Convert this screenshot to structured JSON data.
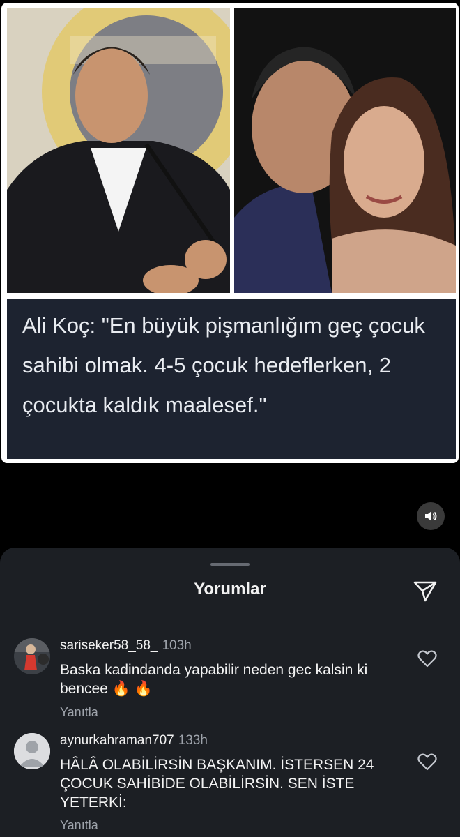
{
  "post": {
    "caption": "Ali Koç: \"En büyük pişmanlığım geç çocuk sahibi olmak. 4-5 çocuk hedeflerken, 2 çocukta kaldık maalesef.\"",
    "sound_icon": "speaker-icon"
  },
  "comments_sheet": {
    "title": "Yorumlar",
    "send_icon": "paper-plane-icon",
    "comments": [
      {
        "username": "sariseker58_58_",
        "time": "103h",
        "text": "Baska kadindanda yapabilir neden gec kalsin ki bencee 🔥 🔥",
        "reply_label": "Yanıtla"
      },
      {
        "username": "aynurkahraman707",
        "time": "133h",
        "text": "HÂLÂ OLABİLİRSİN BAŞKANIM. İSTERSEN 24 ÇOCUK SAHİBİDE OLABİLİRSİN. SEN İSTE YETERKİ:",
        "reply_label": "Yanıtla"
      }
    ]
  },
  "colors": {
    "sheet_bg": "#1c1f24",
    "caption_bg": "#1d2330",
    "muted_text": "#9ea3ab"
  }
}
